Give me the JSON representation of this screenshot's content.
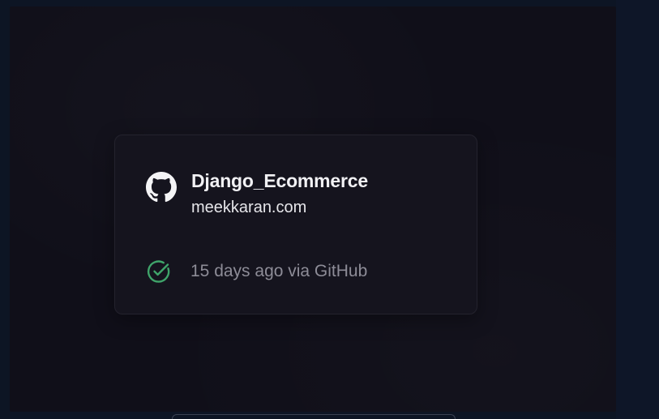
{
  "card": {
    "repo_name": "Django_Ecommerce",
    "domain": "meekkaran.com",
    "repo_icon": "github-icon",
    "status_icon": "check-circle-icon",
    "status_text": "15 days ago via GitHub"
  },
  "colors": {
    "background": "#100f19",
    "card": "#15141e",
    "status_check": "#3fa46a",
    "muted_text": "#8d8c97",
    "primary_text": "#f1f1f4"
  }
}
